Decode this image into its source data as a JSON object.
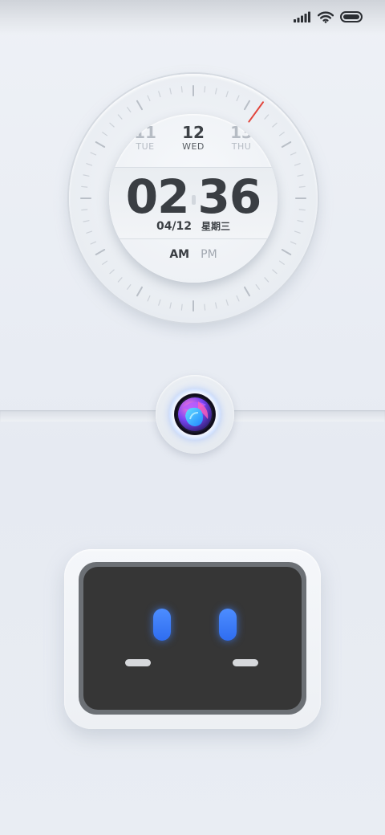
{
  "status_bar": {
    "icons": [
      "signal-icon",
      "wifi-icon",
      "battery-icon"
    ]
  },
  "clock": {
    "days": {
      "prev": {
        "num": "11",
        "weekday": "TUE"
      },
      "current": {
        "num": "12",
        "weekday": "WED"
      },
      "next": {
        "num": "13",
        "weekday": "THU"
      }
    },
    "hour": "02",
    "minute": "36",
    "date": "04/12",
    "weekday_cn": "星期三",
    "am_label": "AM",
    "pm_label": "PM",
    "active_period": "AM",
    "accent_color": "#e2453c"
  },
  "assistant": {
    "icon": "assistant-orb-icon"
  },
  "robot_face": {
    "eye_color": "#3a7bff",
    "screen_color": "#363636"
  }
}
